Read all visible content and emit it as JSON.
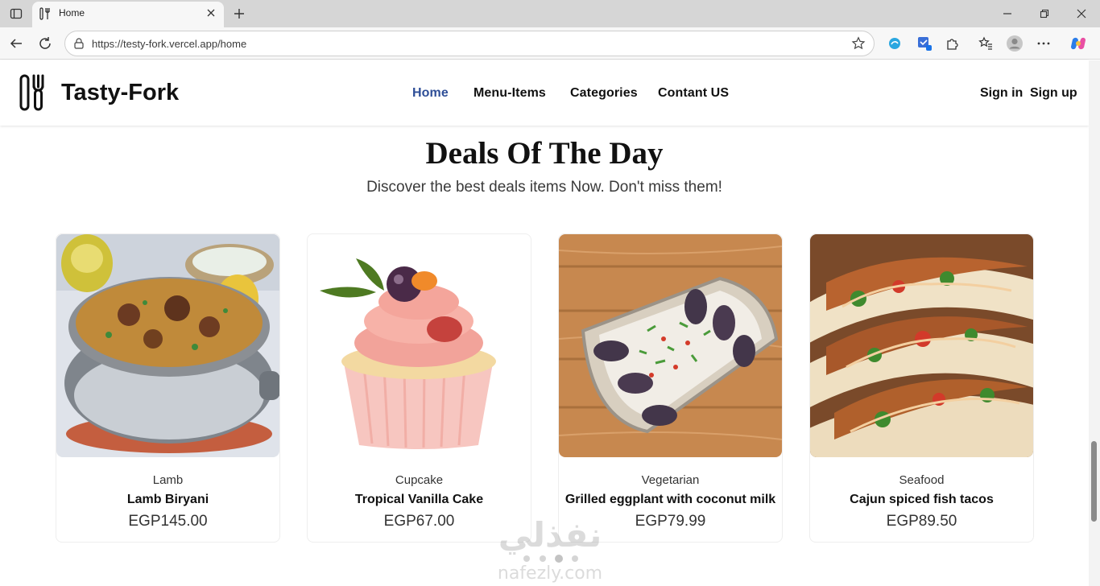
{
  "browser": {
    "tab_title": "Home",
    "url": "https://testy-fork.vercel.app/home"
  },
  "header": {
    "brand": "Tasty-Fork",
    "nav": [
      {
        "label": "Home",
        "active": true
      },
      {
        "label": "Menu-Items",
        "active": false
      },
      {
        "label": "Categories",
        "active": false
      },
      {
        "label": "Contant US",
        "active": false
      }
    ],
    "sign_in": "Sign in",
    "sign_up": "Sign up",
    "active_color": "#2e4e97"
  },
  "deals": {
    "title": "Deals Of The Day",
    "subtitle": "Discover the best deals items Now. Don't miss them!",
    "items": [
      {
        "category": "Lamb",
        "name": "Lamb Biryani",
        "price": "EGP145.00",
        "image": "biryani-pot-photo"
      },
      {
        "category": "Cupcake",
        "name": "Tropical Vanilla Cake",
        "price": "EGP67.00",
        "image": "cupcake-photo"
      },
      {
        "category": "Vegetarian",
        "name": "Grilled eggplant with coconut milk",
        "price": "EGP79.99",
        "image": "eggplant-dish-photo"
      },
      {
        "category": "Seafood",
        "name": "Cajun spiced fish tacos",
        "price": "EGP89.50",
        "image": "fish-tacos-photo"
      }
    ]
  },
  "watermark": {
    "arabic": "نفذلي",
    "latin": "nafezly.com"
  }
}
